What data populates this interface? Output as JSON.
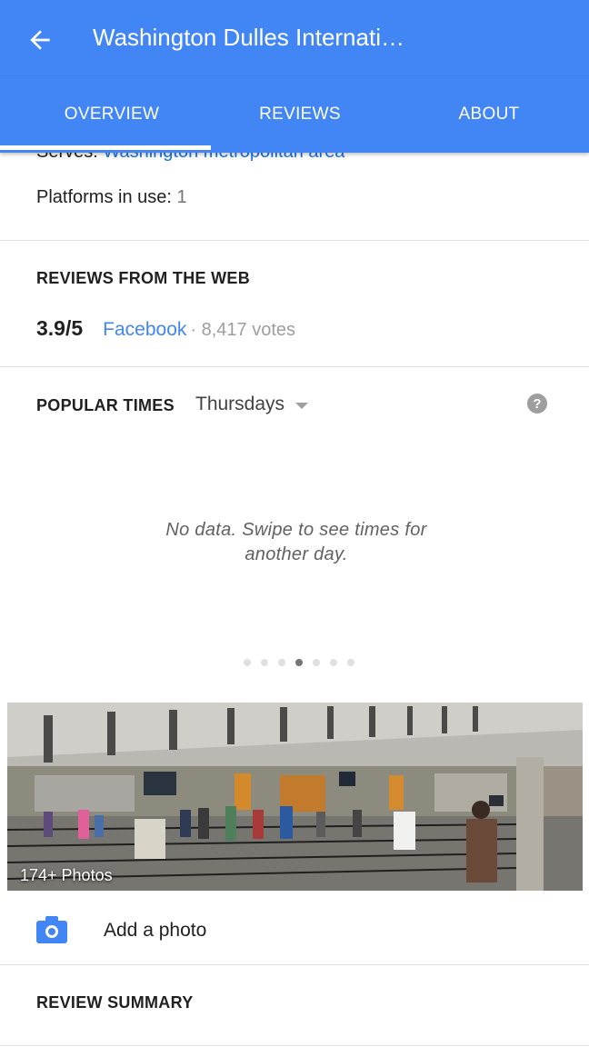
{
  "appbar": {
    "title": "Washington Dulles Internati…",
    "back_icon": "arrow-back-icon",
    "color": "#4285f4"
  },
  "tabs": [
    {
      "label": "OVERVIEW",
      "selected": true
    },
    {
      "label": "REVIEWS",
      "selected": false
    },
    {
      "label": "ABOUT",
      "selected": false
    }
  ],
  "about": {
    "serves_label": "Serves: ",
    "serves_value": "Washington metropolitan area",
    "platforms_label": "Platforms in use: ",
    "platforms_value": "1"
  },
  "reviews_web": {
    "heading": "REVIEWS FROM THE WEB",
    "rating": "3.9/5",
    "source": "Facebook",
    "votes": "· 8,417 votes"
  },
  "popular_times": {
    "heading": "POPULAR TIMES",
    "day": "Thursdays",
    "help_icon": "help-circle-icon",
    "message": "No data. Swipe to see times for another day.",
    "dot_count": 7,
    "active_dot": 3
  },
  "photos": {
    "label": "174+ Photos"
  },
  "add_photo": {
    "label": "Add a photo",
    "icon": "camera-icon",
    "icon_color": "#4285f4"
  },
  "review_summary": {
    "heading": "REVIEW SUMMARY"
  }
}
